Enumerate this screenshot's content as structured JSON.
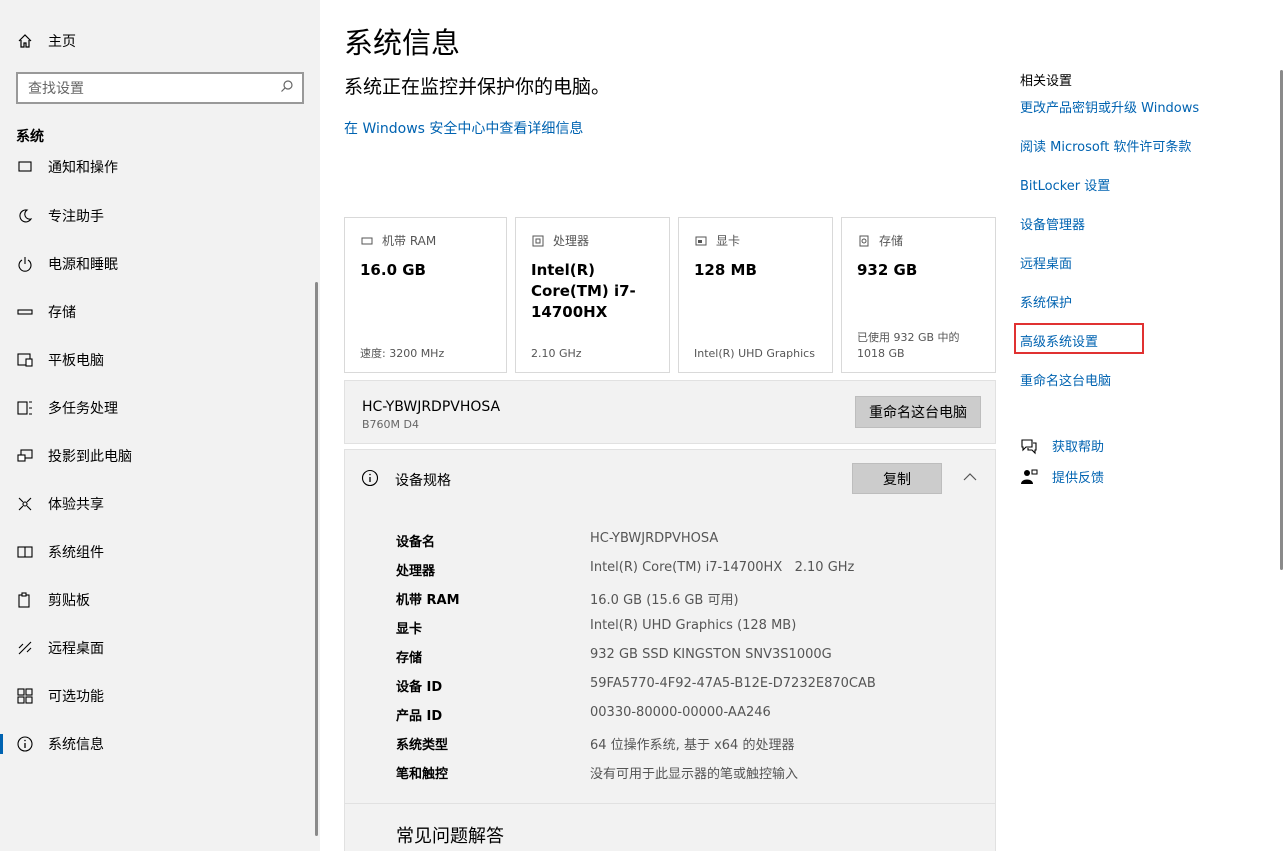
{
  "sidebar": {
    "home_label": "主页",
    "search_placeholder": "查找设置",
    "section_title": "系统",
    "items": [
      {
        "label": "通知和操作",
        "icon": "notification-icon"
      },
      {
        "label": "专注助手",
        "icon": "moon-icon"
      },
      {
        "label": "电源和睡眠",
        "icon": "power-icon"
      },
      {
        "label": "存储",
        "icon": "storage-icon"
      },
      {
        "label": "平板电脑",
        "icon": "tablet-icon"
      },
      {
        "label": "多任务处理",
        "icon": "multitask-icon"
      },
      {
        "label": "投影到此电脑",
        "icon": "project-icon"
      },
      {
        "label": "体验共享",
        "icon": "share-icon"
      },
      {
        "label": "系统组件",
        "icon": "components-icon"
      },
      {
        "label": "剪贴板",
        "icon": "clipboard-icon"
      },
      {
        "label": "远程桌面",
        "icon": "remote-icon"
      },
      {
        "label": "可选功能",
        "icon": "features-icon"
      },
      {
        "label": "系统信息",
        "icon": "info-icon",
        "active": true
      }
    ]
  },
  "main": {
    "title": "系统信息",
    "subtitle": "系统正在监控并保护你的电脑。",
    "security_link": "在 Windows 安全中心中查看详细信息",
    "cards": [
      {
        "label": "机带 RAM",
        "value": "16.0 GB",
        "foot": "速度: 3200 MHz",
        "icon": "ram-icon"
      },
      {
        "label": "处理器",
        "value": "Intel(R) Core(TM) i7-14700HX",
        "foot": "2.10 GHz",
        "icon": "cpu-icon"
      },
      {
        "label": "显卡",
        "value": "128 MB",
        "foot": "Intel(R) UHD Graphics",
        "icon": "gpu-icon"
      },
      {
        "label": "存储",
        "value": "932 GB",
        "foot": "已使用 932 GB 中的 1018 GB",
        "icon": "disk-icon"
      }
    ],
    "device": {
      "name": "HC-YBWJRDPVHOSA",
      "model": "B760M D4",
      "rename_label": "重命名这台电脑"
    },
    "specs": {
      "title": "设备规格",
      "copy_label": "复制",
      "rows": [
        {
          "k": "设备名",
          "v": "HC-YBWJRDPVHOSA"
        },
        {
          "k": "处理器",
          "v": "Intel(R) Core(TM) i7-14700HX   2.10 GHz"
        },
        {
          "k": "机带 RAM",
          "v": "16.0 GB (15.6 GB 可用)"
        },
        {
          "k": "显卡",
          "v": "Intel(R) UHD Graphics (128 MB)"
        },
        {
          "k": "存储",
          "v": "932 GB SSD KINGSTON SNV3S1000G"
        },
        {
          "k": "设备 ID",
          "v": "59FA5770-4F92-47A5-B12E-D7232E870CAB"
        },
        {
          "k": "产品 ID",
          "v": "00330-80000-00000-AA246"
        },
        {
          "k": "系统类型",
          "v": "64 位操作系统, 基于 x64 的处理器"
        },
        {
          "k": "笔和触控",
          "v": "没有可用于此显示器的笔或触控输入"
        }
      ]
    },
    "faq_title": "常见问题解答"
  },
  "related": {
    "title": "相关设置",
    "links": [
      "更改产品密钥或升级 Windows",
      "阅读 Microsoft 软件许可条款",
      "BitLocker 设置",
      "设备管理器",
      "远程桌面",
      "系统保护",
      "高级系统设置",
      "重命名这台电脑"
    ],
    "help_label": "获取帮助",
    "feedback_label": "提供反馈"
  },
  "colors": {
    "accent": "#0063b1",
    "highlight": "#e03131"
  }
}
